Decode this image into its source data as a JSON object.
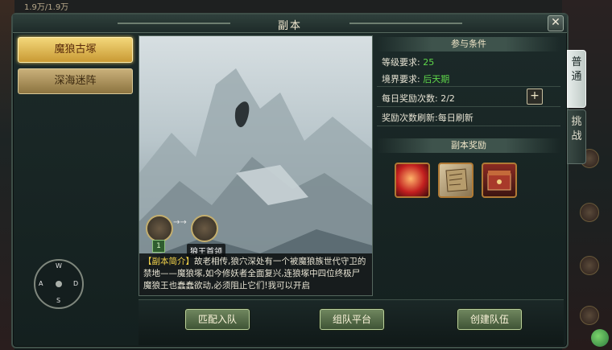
{
  "background": {
    "hp_text": "1.9万/1.9万"
  },
  "window": {
    "title": "副本",
    "close_label": "✕"
  },
  "dungeon_tabs": [
    {
      "label": "魔狼古塚",
      "active": true
    },
    {
      "label": "深海迷阵",
      "active": false
    }
  ],
  "dpad": {
    "up": "W",
    "left": "A",
    "right": "D",
    "down": "S"
  },
  "scene": {
    "node_count": "1",
    "boss_label": "狼王首领",
    "intro_tag": "【副本简介】",
    "intro_text": "故老相传,狼穴深处有一个被魔狼族世代守卫的禁地——魔狼塚,如今修妖者全面复兴,连狼塚中四位终极尸魔狼王也蠢蠢欲动,必须阻止它们!我可以开启"
  },
  "conditions": {
    "header": "参与条件",
    "level_label": "等级要求:",
    "level_value": "25",
    "realm_label": "境界要求:",
    "realm_value": "后天期",
    "daily_label": "每日奖励次数:",
    "daily_value": "2/2",
    "refresh_label": "奖励次数刷新:",
    "refresh_value": "每日刷新"
  },
  "rewards": {
    "header": "副本奖励",
    "items": [
      "red-orb-icon",
      "scroll-map-icon",
      "armor-chest-icon"
    ]
  },
  "side_tabs": [
    {
      "label": "普\n通",
      "active": true
    },
    {
      "label": "挑\n战",
      "active": false
    }
  ],
  "buttons": {
    "match": "匹配入队",
    "team_platform": "组队平台",
    "create_team": "创建队伍"
  },
  "colors": {
    "accent_gold": "#e9c45b",
    "value_green": "#5fd84a",
    "intro_tag": "#f2d24a"
  }
}
